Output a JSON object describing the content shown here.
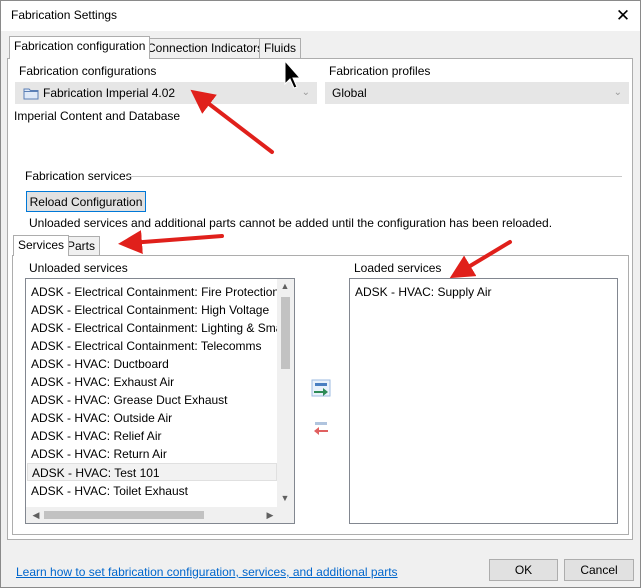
{
  "window": {
    "title": "Fabrication Settings",
    "close_glyph": "✕"
  },
  "tabs": [
    {
      "label": "Fabrication configuration",
      "active": true
    },
    {
      "label": "Connection Indicators",
      "active": false
    },
    {
      "label": "Fluids",
      "active": false
    }
  ],
  "config": {
    "configurations_label": "Fabrication configurations",
    "configuration_value": "Fabrication Imperial 4.02",
    "profiles_label": "Fabrication profiles",
    "profile_value": "Global",
    "content_description": "Imperial Content and Database"
  },
  "services": {
    "section_label": "Fabrication services",
    "reload_button": "Reload Configuration",
    "notice": "Unloaded services and additional parts cannot be added until the configuration has been reloaded.",
    "subtabs": [
      {
        "label": "Services",
        "active": true
      },
      {
        "label": "Parts",
        "active": false
      }
    ],
    "unloaded_label": "Unloaded services",
    "loaded_label": "Loaded services",
    "unloaded_items": [
      "ADSK - Electrical Containment: Fire Protection",
      "ADSK - Electrical Containment: High Voltage",
      "ADSK - Electrical Containment: Lighting & Small Po",
      "ADSK - Electrical Containment: Telecomms",
      "ADSK - HVAC: Ductboard",
      "ADSK - HVAC: Exhaust Air",
      "ADSK - HVAC: Grease Duct Exhaust",
      "ADSK - HVAC: Outside Air",
      "ADSK - HVAC: Relief Air",
      "ADSK - HVAC: Return Air",
      "ADSK - HVAC: Test 101",
      "ADSK - HVAC: Toilet Exhaust"
    ],
    "selected_index": 10,
    "loaded_items": [
      "ADSK - HVAC: Supply Air"
    ]
  },
  "footer": {
    "help_link": "Learn how to set fabrication configuration, services, and additional parts",
    "ok_button": "OK",
    "cancel_button": "Cancel"
  },
  "colors": {
    "annotation_arrow": "#e0201b",
    "add_arrow": "#2e8b57",
    "remove_arrow": "#e06060",
    "link": "#0066cc"
  },
  "icons": {
    "folder": "folder-icon",
    "add": "move-right-icon",
    "remove": "move-left-icon",
    "cursor": "mouse-cursor-icon"
  }
}
